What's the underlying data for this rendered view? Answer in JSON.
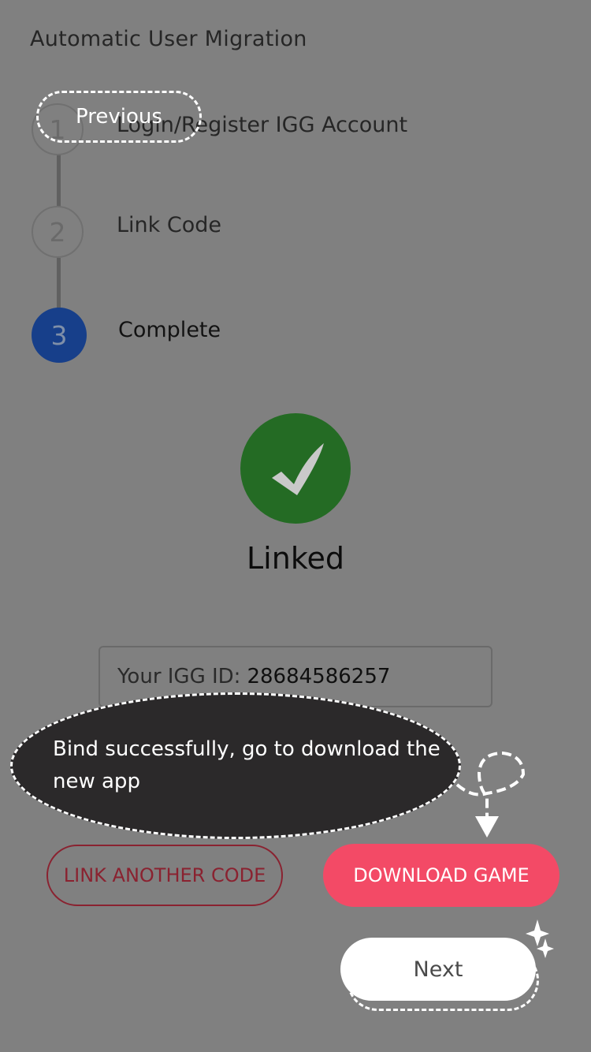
{
  "header": {
    "title": "Automatic User Migration"
  },
  "steps": [
    {
      "number": "1",
      "label": "Login/Register IGG Account",
      "active": false
    },
    {
      "number": "2",
      "label": "Link Code",
      "active": false
    },
    {
      "number": "3",
      "label": "Complete",
      "active": true
    }
  ],
  "overlay": {
    "previous_label": "Previous",
    "bubble_text": "Bind successfully, go to download the new app",
    "next_label": "Next"
  },
  "result": {
    "status": "Linked",
    "igg_label": "Your IGG ID:",
    "igg_value": "28684586257"
  },
  "actions": {
    "link_another_label": "LINK ANOTHER CODE",
    "download_label": "DOWNLOAD GAME"
  },
  "colors": {
    "overlay_bg": "#808080",
    "active_step": "#173f8a",
    "success": "#246b24",
    "download_button": "#f34a66",
    "link_another_border": "#8a2230",
    "bubble_bg": "#2b292a"
  },
  "icons": {
    "success": "check-icon",
    "guide_arrow": "arrow-down-icon",
    "sparkle": "sparkle-icon"
  }
}
